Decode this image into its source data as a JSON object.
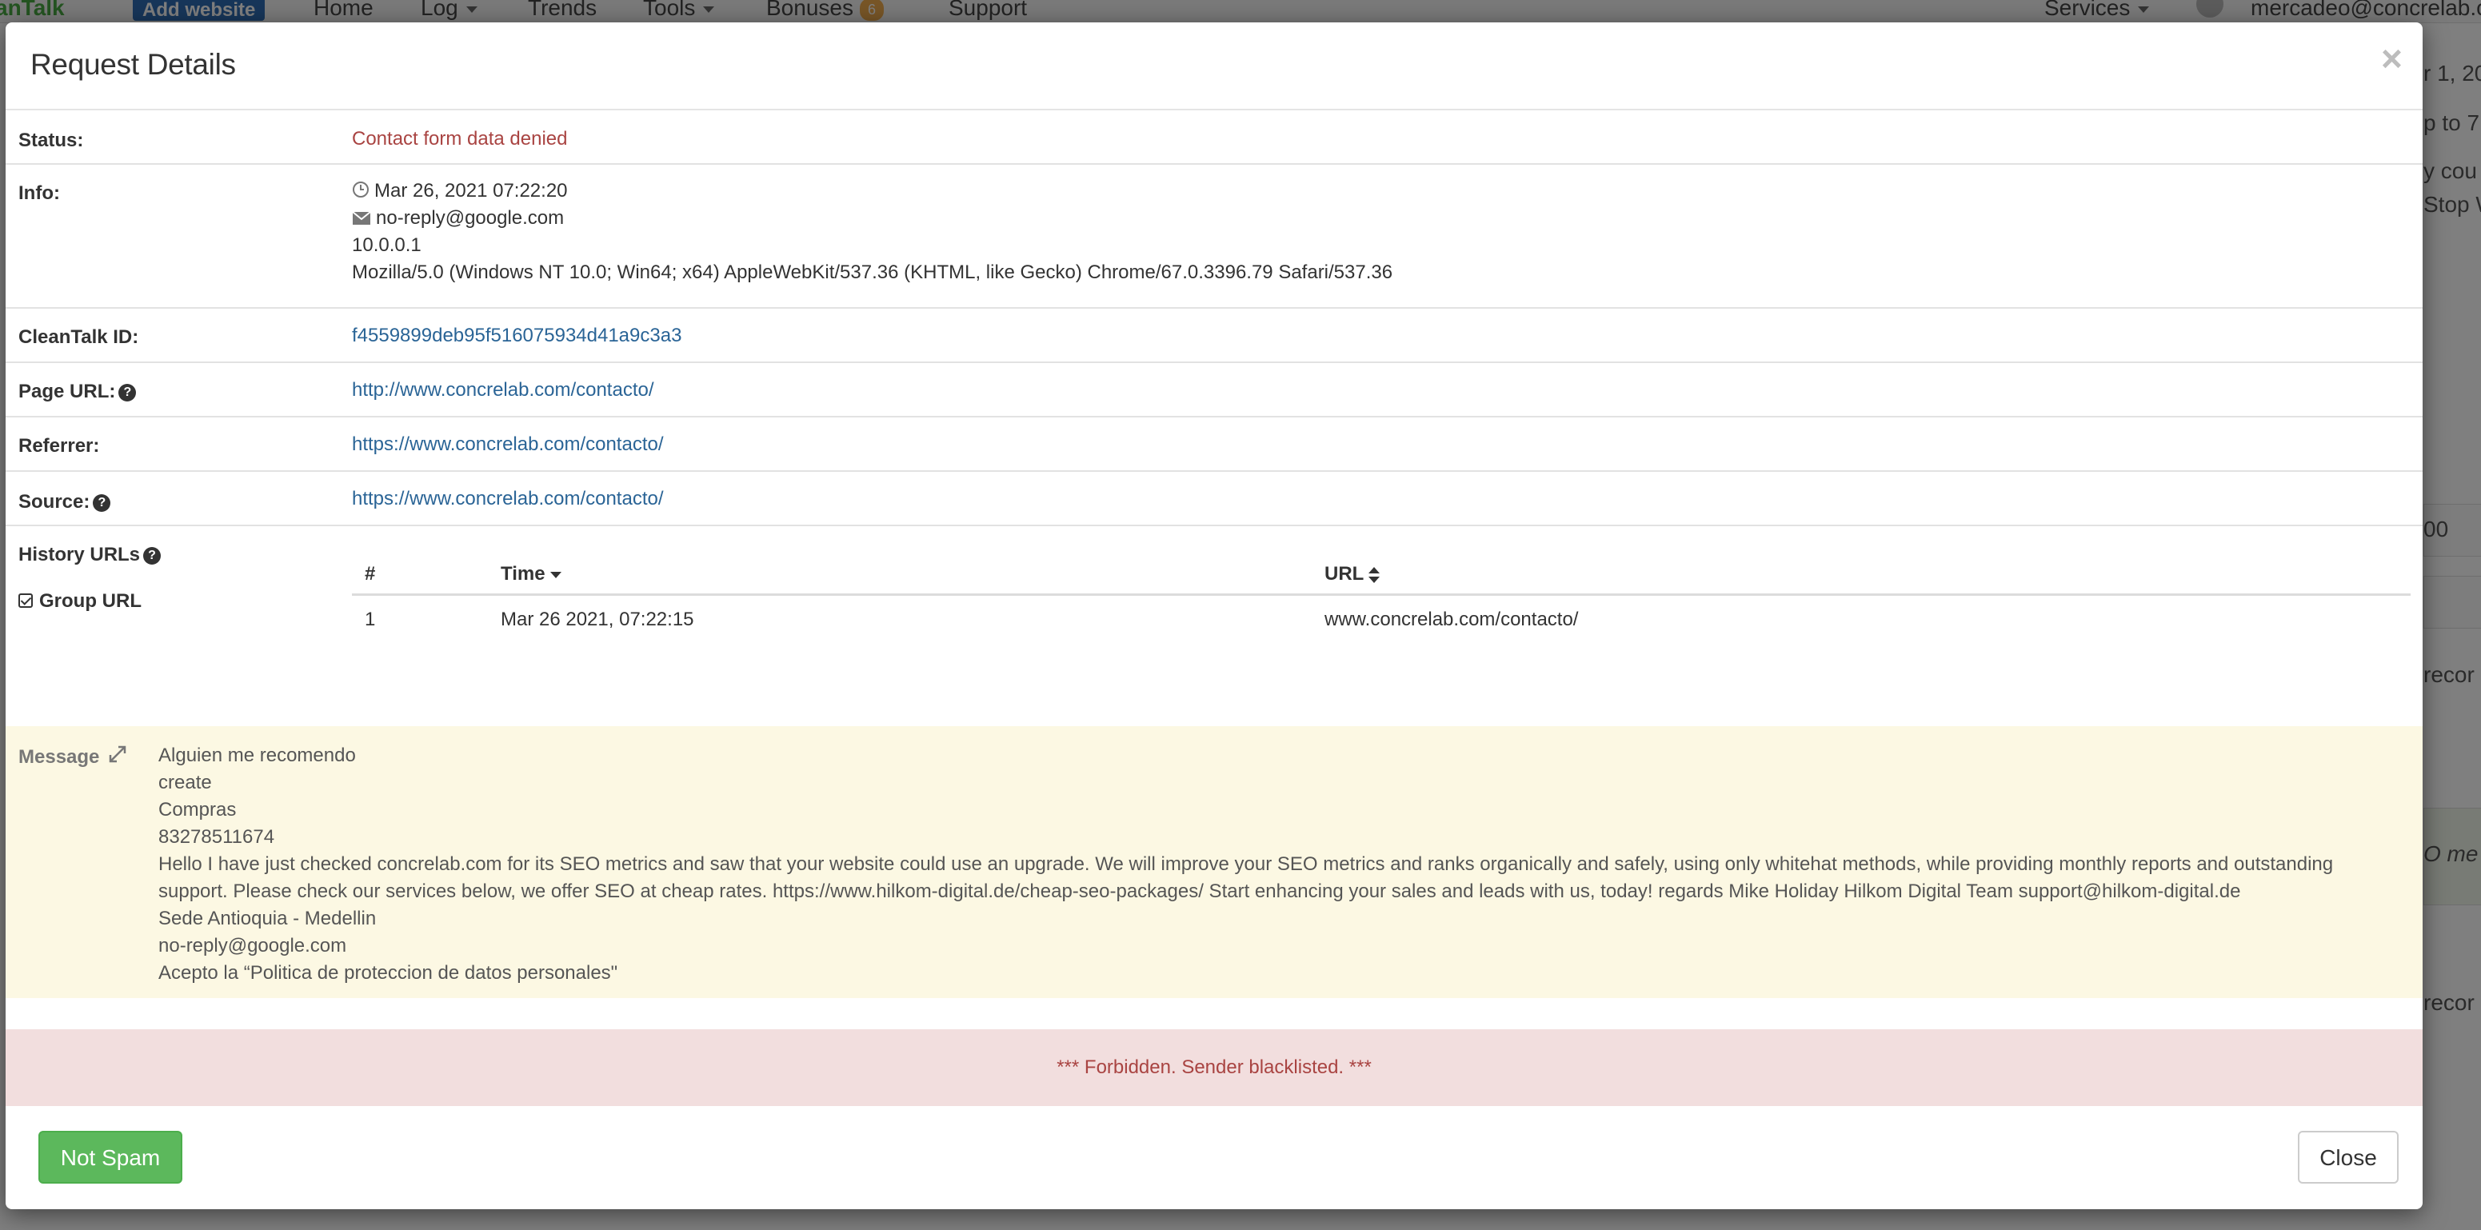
{
  "background": {
    "logo": "anTalk",
    "add_website": "Add website",
    "nav": {
      "home": "Home",
      "log": "Log",
      "trends": "Trends",
      "tools": "Tools",
      "bonuses": "Bonuses",
      "bonuses_count": "6",
      "support": "Support",
      "services": "Services"
    },
    "user_email": "mercadeo@concrelab.c",
    "right_snippets": {
      "date": "r 1, 20",
      "p_to": "p to 7",
      "y_cou": "y cou",
      "stop_w": "Stop W",
      "zero": "00",
      "recor1": "recor",
      "o_me": "O me",
      "recor2": "recor"
    }
  },
  "modal": {
    "title": "Request Details",
    "close_x": "×",
    "status": {
      "label": "Status:",
      "value": "Contact form data denied"
    },
    "info": {
      "label": "Info:",
      "datetime": "Mar 26, 2021 07:22:20",
      "email": "no-reply@google.com",
      "ip": "10.0.0.1",
      "user_agent": "Mozilla/5.0 (Windows NT 10.0; Win64; x64) AppleWebKit/537.36 (KHTML, like Gecko) Chrome/67.0.3396.79 Safari/537.36"
    },
    "cleantalk_id": {
      "label": "CleanTalk ID:",
      "value": "f4559899deb95f516075934d41a9c3a3"
    },
    "page_url": {
      "label": "Page URL:",
      "value": "http://www.concrelab.com/contacto/"
    },
    "referrer": {
      "label": "Referrer:",
      "value": "https://www.concrelab.com/contacto/"
    },
    "source": {
      "label": "Source:",
      "value": "https://www.concrelab.com/contacto/"
    },
    "history": {
      "label": "History URLs",
      "group_label": "Group URL",
      "columns": [
        "#",
        "Time",
        "URL"
      ],
      "rows": [
        [
          "1",
          "Mar 26 2021, 07:22:15",
          "www.concrelab.com/contacto/"
        ]
      ]
    },
    "message": {
      "label": "Message",
      "lines": [
        "Alguien me recomendo",
        "create",
        "Compras",
        "83278511674",
        "Hello I have just checked concrelab.com for its SEO metrics and saw that your website could use an upgrade. We will improve your SEO metrics and ranks organically and safely, using only whitehat methods, while providing monthly reports and outstanding support. Please check our services below, we offer SEO at cheap rates. https://www.hilkom-digital.de/cheap-seo-packages/ Start enhancing your sales and leads with us, today! regards Mike Holiday Hilkom Digital Team support@hilkom-digital.de",
        "Sede Antioquia - Medellin",
        "no-reply@google.com",
        "Acepto la “Politica de proteccion de datos personales\""
      ]
    },
    "alert": "*** Forbidden. Sender blacklisted. ***",
    "buttons": {
      "not_spam": "Not Spam",
      "close": "Close"
    }
  },
  "colors": {
    "status_red": "#a94442",
    "link_blue": "#2a6496",
    "message_bg": "#fcf8e3",
    "alert_bg": "#f2dede",
    "success_green": "#5cb85c"
  }
}
